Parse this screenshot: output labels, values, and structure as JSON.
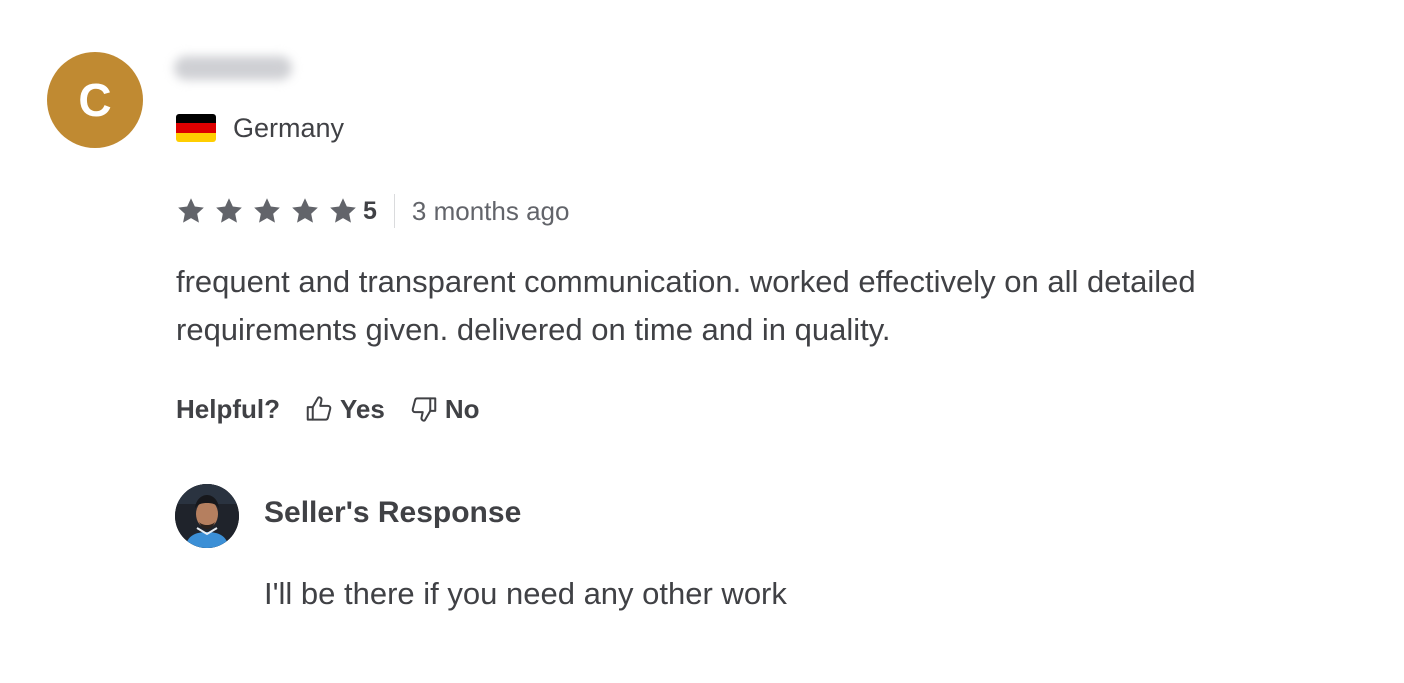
{
  "reviewer": {
    "avatar_initial": "C",
    "avatar_color": "#c08a32",
    "country": "Germany",
    "flag_colors": [
      "#000000",
      "#dd0000",
      "#ffce00"
    ]
  },
  "rating": {
    "stars": 5,
    "value": "5",
    "time": "3 months ago",
    "star_color": "#62646a"
  },
  "review_text": "frequent and transparent communication. worked effectively on all detailed requirements given. delivered on time and in quality.",
  "helpful": {
    "label": "Helpful?",
    "yes": "Yes",
    "no": "No"
  },
  "seller_response": {
    "title": "Seller's Response",
    "text": "I'll be there if you need any other work"
  }
}
